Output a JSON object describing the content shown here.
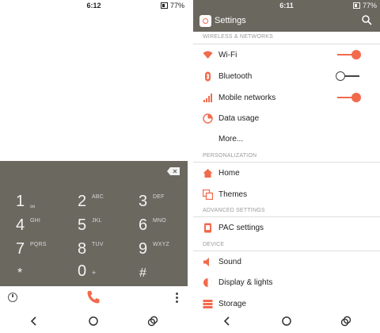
{
  "left": {
    "status": {
      "time": "6:12",
      "battery": "77%"
    },
    "dialpad": {
      "keys": [
        {
          "digit": "1",
          "letters": "∞"
        },
        {
          "digit": "2",
          "letters": "ABC"
        },
        {
          "digit": "3",
          "letters": "DEF"
        },
        {
          "digit": "4",
          "letters": "GHI"
        },
        {
          "digit": "5",
          "letters": "JKL"
        },
        {
          "digit": "6",
          "letters": "MNO"
        },
        {
          "digit": "7",
          "letters": "PQRS"
        },
        {
          "digit": "8",
          "letters": "TUV"
        },
        {
          "digit": "9",
          "letters": "WXYZ"
        },
        {
          "digit": "*",
          "letters": ""
        },
        {
          "digit": "0",
          "letters": "+"
        },
        {
          "digit": "#",
          "letters": ""
        }
      ]
    },
    "icons": {
      "call": "phone-icon",
      "history": "history-icon",
      "more": "more-vert-icon"
    }
  },
  "right": {
    "status": {
      "time": "6:11",
      "battery": "77%"
    },
    "appbar": {
      "title": "Settings"
    },
    "sections": [
      {
        "header": "WIRELESS & NETWORKS",
        "items": [
          {
            "label": "Wi-Fi",
            "icon": "wifi-icon",
            "toggle": "on"
          },
          {
            "label": "Bluetooth",
            "icon": "bluetooth-icon",
            "toggle": "off"
          },
          {
            "label": "Mobile networks",
            "icon": "signal-icon",
            "toggle": "on"
          },
          {
            "label": "Data usage",
            "icon": "data-usage-icon"
          },
          {
            "label": "More...",
            "icon": ""
          }
        ]
      },
      {
        "header": "PERSONALIZATION",
        "items": [
          {
            "label": "Home",
            "icon": "home-icon"
          },
          {
            "label": "Themes",
            "icon": "themes-icon"
          }
        ]
      },
      {
        "header": "ADVANCED SETTINGS",
        "items": [
          {
            "label": "PAC settings",
            "icon": "pac-icon"
          }
        ]
      },
      {
        "header": "DEVICE",
        "items": [
          {
            "label": "Sound",
            "icon": "sound-icon"
          },
          {
            "label": "Display & lights",
            "icon": "display-icon"
          },
          {
            "label": "Storage",
            "icon": "storage-icon"
          }
        ]
      }
    ]
  },
  "colors": {
    "accent": "#f26a4c",
    "dialpad_bg": "#6b6860",
    "appbar_bg": "#6a675f"
  }
}
